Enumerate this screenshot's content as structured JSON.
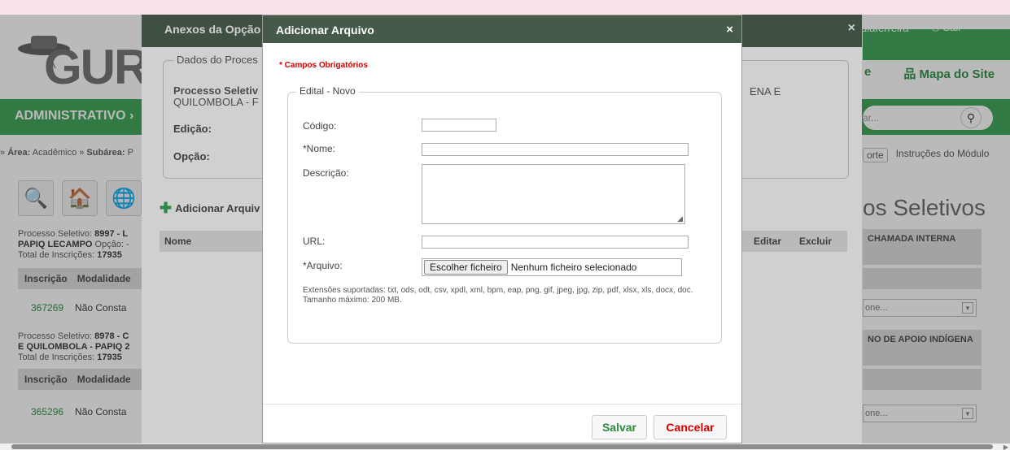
{
  "page": {
    "logo_text": "GURI",
    "admin_label": "ADMINISTRATIVO ›",
    "breadcrumb": {
      "area_label": "Área:",
      "area_value": "Acadêmico",
      "subarea_label": "Subárea:",
      "subarea_value": "P"
    },
    "user": {
      "name": "diaferreira",
      "logout": "Sair"
    },
    "links": {
      "left": "e",
      "mapa": "Mapa do Site"
    },
    "search_placeholder": "ar...",
    "suporte": "orte",
    "instrucoes": "Instruções do Módulo",
    "big_title": "os Seletivos",
    "processes": [
      {
        "line1": "Processo Seletivo: ",
        "num": "8997 - L",
        "line2": "PAPIQ LECAMPO",
        "opcao": " Opção: -",
        "total_label": "Total de Inscrições: ",
        "total": "17935",
        "right_head": "CHAMADA INTERNA",
        "row_insc": "367269",
        "row_mod": "Não Consta",
        "select": "one..."
      },
      {
        "line1": "Processo Seletivo: ",
        "num": "8978 - C",
        "line2": "E QUILOMBOLA - PAPIQ 2",
        "opcao": "",
        "total_label": "Total de Inscrições: ",
        "total": "17935",
        "right_head": "NO DE APOIO INDÍGENA",
        "row_insc": "365296",
        "row_mod": "Não Consta",
        "select": "one..."
      }
    ],
    "table_cols": {
      "inscricao": "Inscrição",
      "modalidade": "Modalidade"
    }
  },
  "dialog_anexos": {
    "title": "Anexos da Opção",
    "close": "×",
    "legend": "Dados do Proces",
    "processo_label": "Processo Seletiv",
    "processo_line2": "QUILOMBOLA - F",
    "processo_right": "ENA E",
    "edicao_label": "Edição:",
    "opcao_label": "Opção:",
    "add_label": "Adicionar Arquiv",
    "col_nome": "Nome",
    "col_editar": "Editar",
    "col_excluir": "Excluir"
  },
  "dialog_arquivo": {
    "title": "Adicionar Arquivo",
    "close": "×",
    "required_note": "* Campos Obrigatórios",
    "legend": "Edital - Novo",
    "codigo_label": "Código:",
    "nome_label": "*Nome:",
    "descricao_label": "Descrição:",
    "url_label": "URL:",
    "arquivo_label": "*Arquivo:",
    "file_button": "Escolher ficheiro",
    "file_status": "Nenhum ficheiro selecionado",
    "extensoes": "Extensões suportadas: txt, ods, odt, csv, xpdl, xml, bpm, eap, png, gif, jpeg, jpg, zip, pdf, xlsx, xls, docx, doc.",
    "tamanho": "Tamanho máximo: 200 MB.",
    "salvar": "Salvar",
    "cancelar": "Cancelar"
  }
}
